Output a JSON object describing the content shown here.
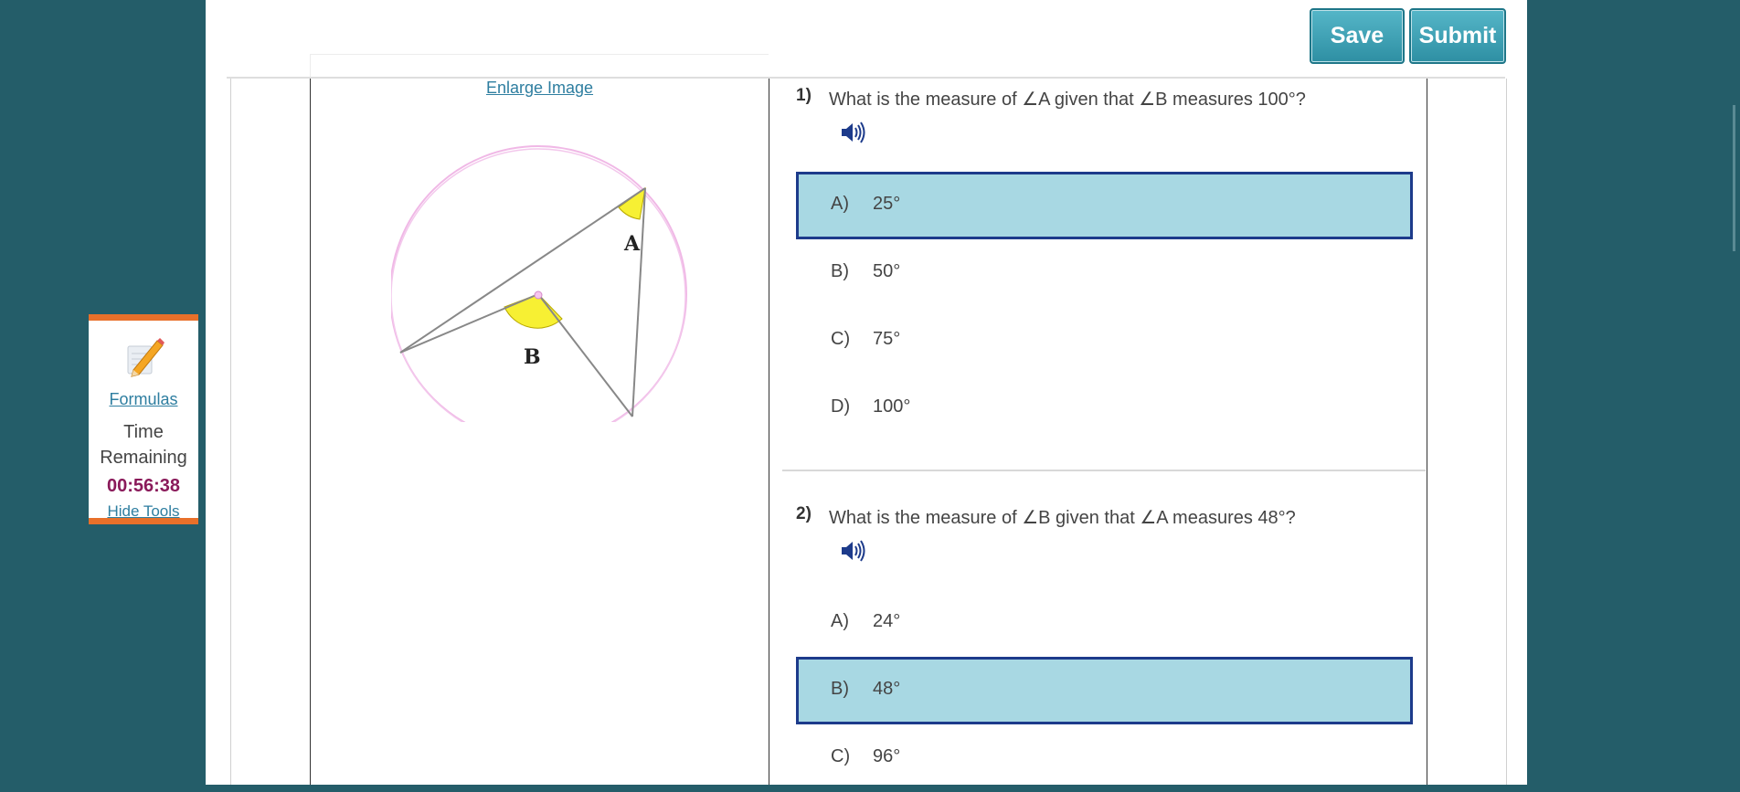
{
  "toolbar": {
    "save_label": "Save",
    "submit_label": "Submit"
  },
  "figure": {
    "enlarge_link": "Enlarge Image",
    "label_a": "A",
    "label_b": "B"
  },
  "sidebar": {
    "icon": "pencil-icon",
    "formulas_link": "Formulas",
    "time_label": "Time Remaining",
    "time_value": "00:56:38",
    "hide_tools_link": "Hide Tools"
  },
  "questions": [
    {
      "number": "1)",
      "text": "What is the measure of ∠A given that ∠B measures 100°?",
      "choices": [
        {
          "letter": "A)",
          "value": "25°",
          "selected": true
        },
        {
          "letter": "B)",
          "value": "50°",
          "selected": false
        },
        {
          "letter": "C)",
          "value": "75°",
          "selected": false
        },
        {
          "letter": "D)",
          "value": "100°",
          "selected": false
        }
      ]
    },
    {
      "number": "2)",
      "text": "What is the measure of ∠B given that ∠A measures 48°?",
      "choices": [
        {
          "letter": "A)",
          "value": "24°",
          "selected": false
        },
        {
          "letter": "B)",
          "value": "48°",
          "selected": true
        },
        {
          "letter": "C)",
          "value": "96°",
          "selected": false
        }
      ]
    }
  ],
  "colors": {
    "background": "#245d69",
    "button": "#3fa2b6",
    "selected_fill": "#a8d8e3",
    "selected_border": "#1d3b8b",
    "timer": "#8a1a5a",
    "sidebar_accent": "#e8702a"
  }
}
